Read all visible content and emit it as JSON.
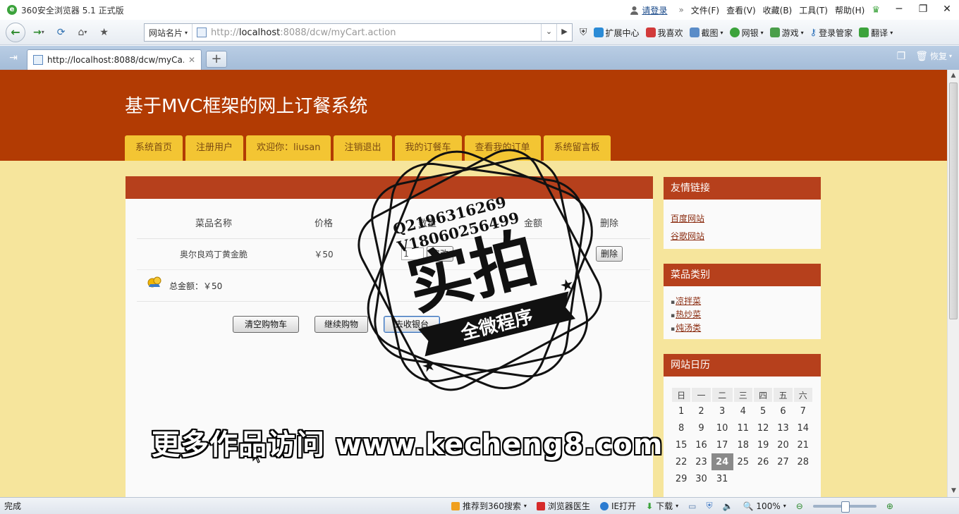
{
  "window": {
    "title": "360安全浏览器 5.1 正式版",
    "login": "请登录",
    "menus": [
      "文件(F)",
      "查看(V)",
      "收藏(B)",
      "工具(T)",
      "帮助(H)"
    ]
  },
  "toolbar": {
    "site_card": "网站名片",
    "url_prefix": "http://",
    "url_host": "localhost",
    "url_rest": ":8088/dcw/myCart.action",
    "items": [
      "扩展中心",
      "我喜欢",
      "截图",
      "网银",
      "游戏",
      "登录管家",
      "翻译"
    ]
  },
  "tabs": {
    "active_title": "http://localhost:8088/dcw/myCa...",
    "restore": "恢复"
  },
  "page": {
    "site_title": "基于MVC框架的网上订餐系统",
    "nav": [
      "系统首页",
      "注册用户",
      "欢迎你：liusan",
      "注销退出",
      "我的订餐车",
      "查看我的订单",
      "系统留言板"
    ],
    "cart": {
      "headers": [
        "菜品名称",
        "价格",
        "数量",
        "金额",
        "删除"
      ],
      "rows": [
        {
          "name": "奥尔良鸡丁黄金脆",
          "price": "￥50",
          "qty": "1",
          "update": "修改",
          "amount": "",
          "delete": "删除"
        }
      ],
      "total_label": "总金额：￥50",
      "actions": [
        "清空购物车",
        "继续购物",
        "去收银台"
      ]
    },
    "sidebar": {
      "links_title": "友情链接",
      "links": [
        "百度网站",
        "谷歌网站"
      ],
      "categories_title": "菜品类别",
      "categories": [
        "凉拌菜",
        "热炒菜",
        "炖汤类"
      ],
      "calendar_title": "网站日历",
      "weekdays": [
        "日",
        "一",
        "二",
        "三",
        "四",
        "五",
        "六"
      ],
      "weeks": [
        [
          "1",
          "2",
          "3",
          "4",
          "5",
          "6",
          "7"
        ],
        [
          "8",
          "9",
          "10",
          "11",
          "12",
          "13",
          "14"
        ],
        [
          "15",
          "16",
          "17",
          "18",
          "19",
          "20",
          "21"
        ],
        [
          "22",
          "23",
          "24",
          "25",
          "26",
          "27",
          "28"
        ],
        [
          "29",
          "30",
          "31",
          "",
          "",
          "",
          ""
        ]
      ],
      "today": "24"
    }
  },
  "watermark": {
    "qq": "Q2196316269",
    "vx": "V18060256499",
    "big": "实拍",
    "ribbon": "全微程序",
    "promo": "更多作品访问 www.kecheng8.com"
  },
  "statusbar": {
    "status": "完成",
    "items": [
      "推荐到360搜索",
      "浏览器医生",
      "IE打开",
      "下载"
    ],
    "zoom": "100%"
  },
  "colors": {
    "header": "#b23b03",
    "page_bg": "#f6e59c",
    "nav_tab": "#f3c533",
    "panel_head": "#b6401c"
  }
}
